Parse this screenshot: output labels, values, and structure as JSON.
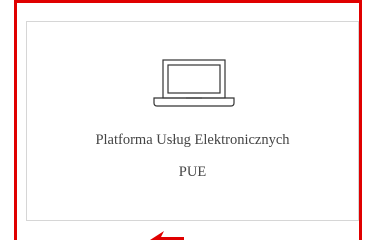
{
  "card": {
    "icon": "laptop-icon",
    "title": "Platforma Usług Elektronicznych",
    "subtitle": "PUE"
  },
  "colors": {
    "highlight_frame": "#e00000",
    "card_border": "#d6d6d6",
    "text": "#444444",
    "icon_stroke": "#333333"
  }
}
